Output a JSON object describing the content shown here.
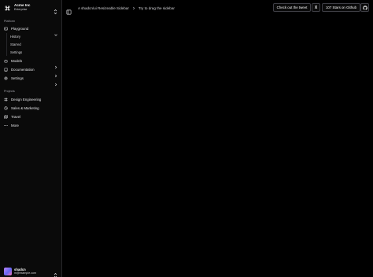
{
  "team": {
    "name": "Acme Inc",
    "plan": "Enterprise"
  },
  "platform": {
    "label": "Platform",
    "items": [
      {
        "label": "Playground",
        "icon": "terminal-icon",
        "expanded": true
      },
      {
        "label": "Models",
        "icon": "bot-icon"
      },
      {
        "label": "Documentation",
        "icon": "book-icon"
      },
      {
        "label": "Settings",
        "icon": "gear-icon"
      }
    ],
    "playground_sub": [
      "History",
      "Starred",
      "Settings"
    ]
  },
  "projects": {
    "label": "Projects",
    "items": [
      {
        "label": "Design Engineering",
        "icon": "frame-icon"
      },
      {
        "label": "Sales & Marketing",
        "icon": "pie-chart-icon"
      },
      {
        "label": "Travel",
        "icon": "map-icon"
      },
      {
        "label": "More",
        "icon": "more-icon"
      }
    ]
  },
  "user": {
    "name": "shadcn",
    "email": "m@example.com"
  },
  "breadcrumb": [
    "A shadcn/ui Resizeable Sidebar",
    "Try to drag the sidebar"
  ],
  "header": {
    "tweet_label": "Check out the tweet",
    "x_label": "X",
    "stars_label": "107 Stars on Github"
  }
}
